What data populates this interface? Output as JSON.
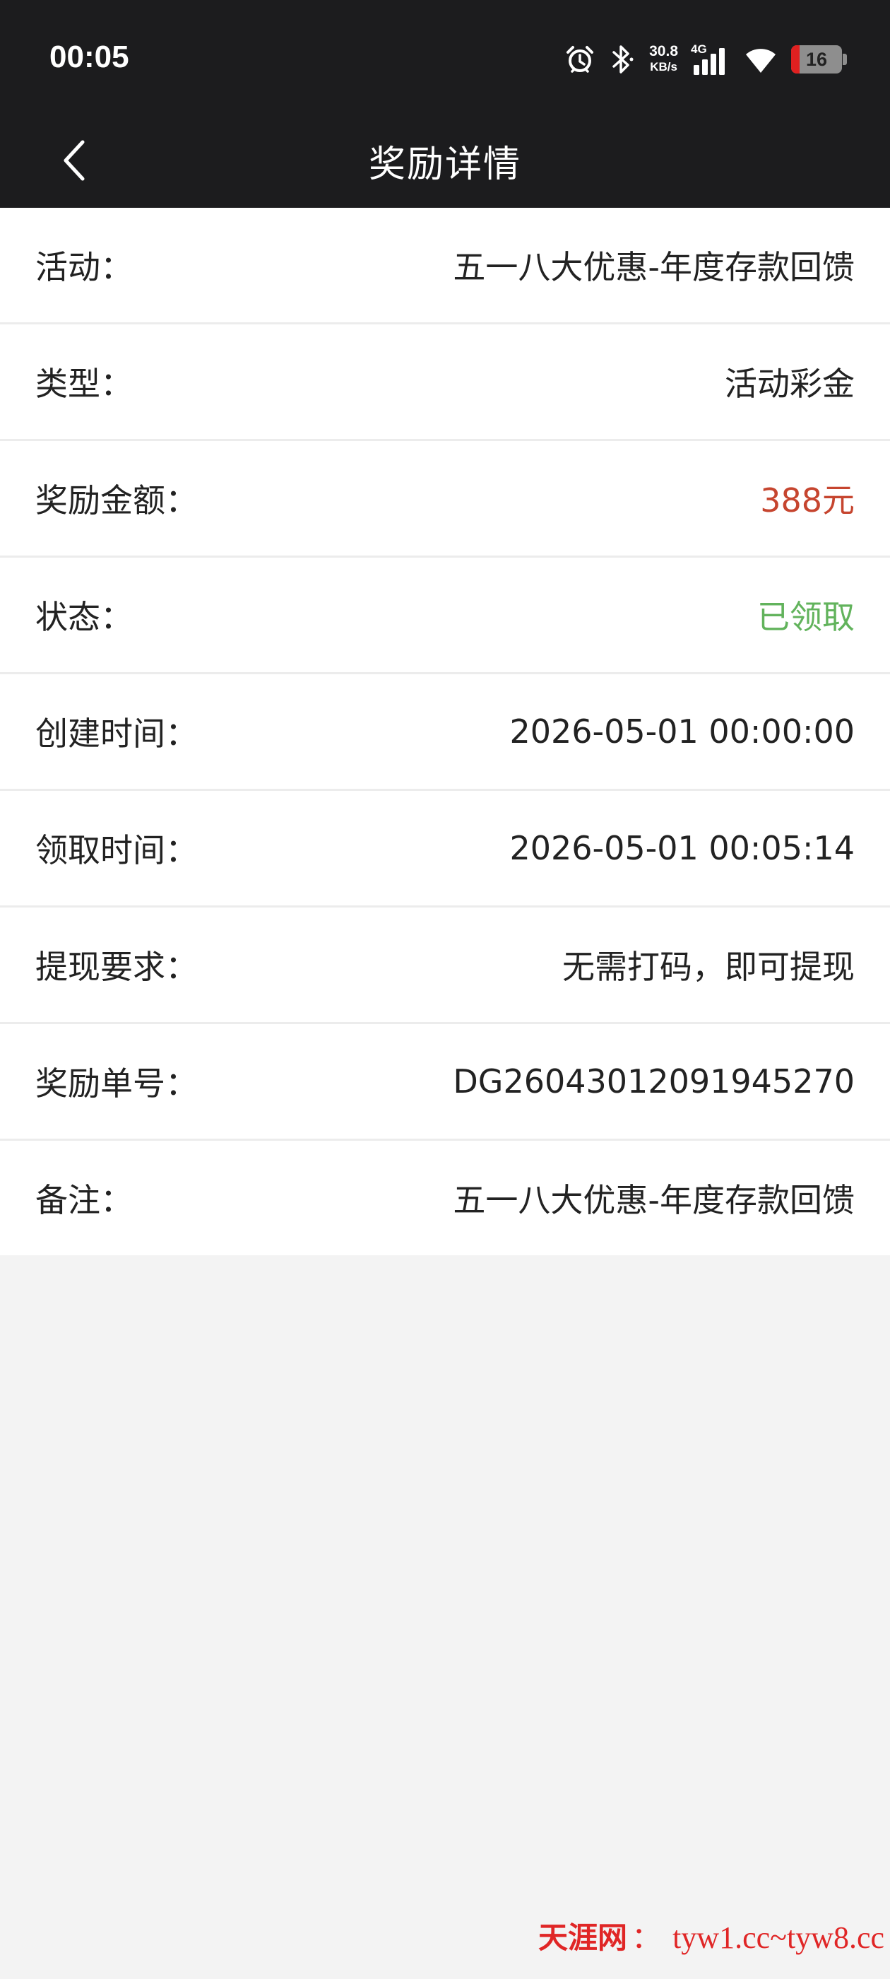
{
  "status_bar": {
    "time": "00:05",
    "net_speed_value": "30.8",
    "net_speed_unit": "KB/s",
    "network_type": "4G",
    "battery_level": "16",
    "icons": [
      "alarm-icon",
      "bluetooth-icon",
      "net-speed",
      "cellular-signal-icon",
      "wifi-icon",
      "battery-icon"
    ],
    "colors": {
      "background": "#1c1c1e",
      "battery_low": "#e02020"
    }
  },
  "header": {
    "title": "奖励详情",
    "back_icon": "chevron-left-icon"
  },
  "details": [
    {
      "label": "活动：",
      "value": "五一八大优惠-年度存款回馈"
    },
    {
      "label": "类型：",
      "value": "活动彩金"
    },
    {
      "label": "奖励金额：",
      "value": "388元",
      "color": "#c6452f"
    },
    {
      "label": "状态：",
      "value": "已领取",
      "color": "#62b35c"
    },
    {
      "label": "创建时间：",
      "value": "2026-05-01 00:00:00"
    },
    {
      "label": "领取时间：",
      "value": "2026-05-01 00:05:14"
    },
    {
      "label": "提现要求：",
      "value": "无需打码，即可提现"
    },
    {
      "label": "奖励单号：",
      "value": "DG26043012091945270"
    },
    {
      "label": "备注：",
      "value": "五一八大优惠-年度存款回馈"
    }
  ],
  "watermark": {
    "brand": "天涯网",
    "colon": "：",
    "url": "tyw1.cc~tyw8.cc"
  }
}
